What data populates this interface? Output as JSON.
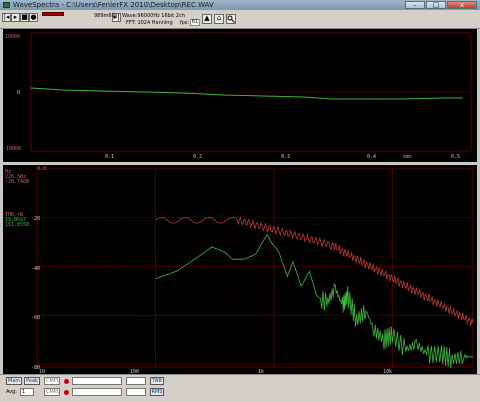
{
  "window": {
    "title": "WaveSpectra - C:\\Users\\FenlerFX 2010\\Desktop\\REC.WAV",
    "min_label": "–",
    "max_label": "□",
    "close_label": "x"
  },
  "toolbar": {
    "btn_1": "|◂",
    "btn_2": "▸",
    "btn_3": "■",
    "btn_4": "●",
    "btn_5": "▸|",
    "time_label": "989m69s",
    "wave_info": "Wave:96000Hz 16bit 2ch",
    "fft_info": "FFT: 1024 Hanning",
    "fps_label": "fps:",
    "fps_value": "61",
    "icon_a": "▲",
    "icon_b": "⌂"
  },
  "waveform": {
    "y_top": "10000",
    "y_mid": "0",
    "y_bot": "-10000",
    "x_ticks": [
      "0.1",
      "0.2",
      "0.3",
      "0.4",
      "0.5"
    ],
    "x_unit": "sec"
  },
  "spectrum": {
    "db_top": "0.0",
    "hz_label": "Hz",
    "ch1_freq": "226.5Hz",
    "ch1_db": "-20.74dB",
    "thd_label": "THD.+N",
    "thd_val1": "59.8697",
    "thd_val2": "151.8558",
    "y_ticks": [
      "-20",
      "-40",
      "-60",
      "-80"
    ],
    "x_ticks": [
      "10",
      "100",
      "1k",
      "10k"
    ],
    "ch1_color": "#b83a3a",
    "ch2_color": "#3cb83c"
  },
  "status": {
    "main_btn": "Main",
    "peak_btn": "Peak",
    "cmp_field": "CMPL",
    "tab_btn": "TAB",
    "avg_label": "Avg:",
    "avg_value": "1",
    "cmpl2_field": "CMPL",
    "rms_btn": "RMS"
  }
}
